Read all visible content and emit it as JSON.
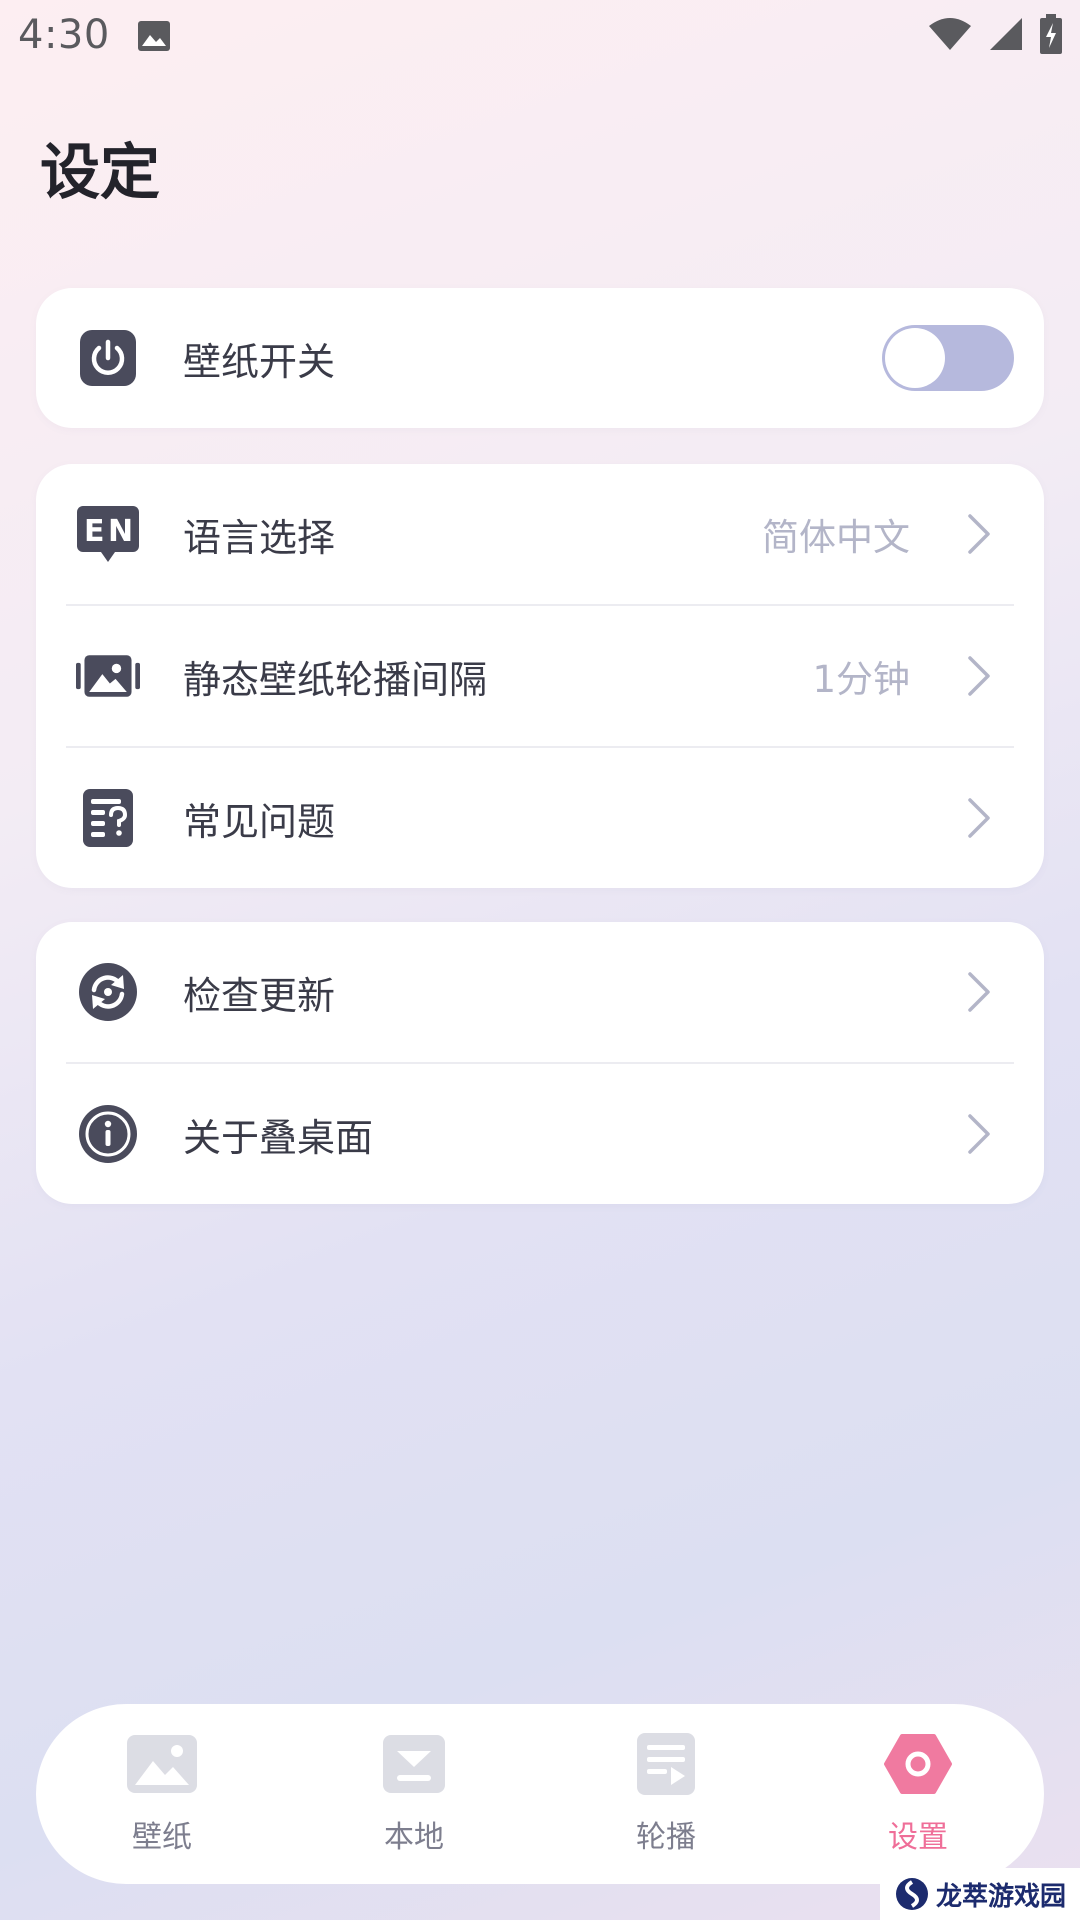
{
  "status_bar": {
    "time": "4:30",
    "icons": [
      "gallery-icon",
      "wifi-icon",
      "signal-icon",
      "battery-charging-icon"
    ]
  },
  "page": {
    "title": "设定"
  },
  "card_power": {
    "wallpaper_switch_label": "壁纸开关",
    "wallpaper_switch_on": false,
    "toggle_color": "#b6b9dd"
  },
  "card_settings": {
    "language_label": "语言选择",
    "language_value": "简体中文",
    "language_icon": "en-language-icon",
    "interval_label": "静态壁纸轮播间隔",
    "interval_value": "1分钟",
    "interval_icon": "image-carousel-icon",
    "faq_label": "常见问题",
    "faq_icon": "faq-document-icon"
  },
  "card_about": {
    "update_label": "检查更新",
    "update_icon": "refresh-icon",
    "about_label": "关于叠桌面",
    "about_icon": "info-icon"
  },
  "bottom_nav": {
    "items": [
      {
        "label": "壁纸",
        "icon": "wallpaper-icon",
        "active": false
      },
      {
        "label": "本地",
        "icon": "local-download-icon",
        "active": false
      },
      {
        "label": "轮播",
        "icon": "carousel-playlist-icon",
        "active": false
      },
      {
        "label": "设置",
        "icon": "settings-hexagon-icon",
        "active": true
      }
    ],
    "active_color": "#ef6e98",
    "inactive_color": "#7d7e8e"
  },
  "watermark": {
    "text": "龙萃游戏园"
  },
  "colors": {
    "icon_dark": "#4a4b5c",
    "value_gray": "#b3b5c8",
    "card_bg": "#ffffff"
  }
}
